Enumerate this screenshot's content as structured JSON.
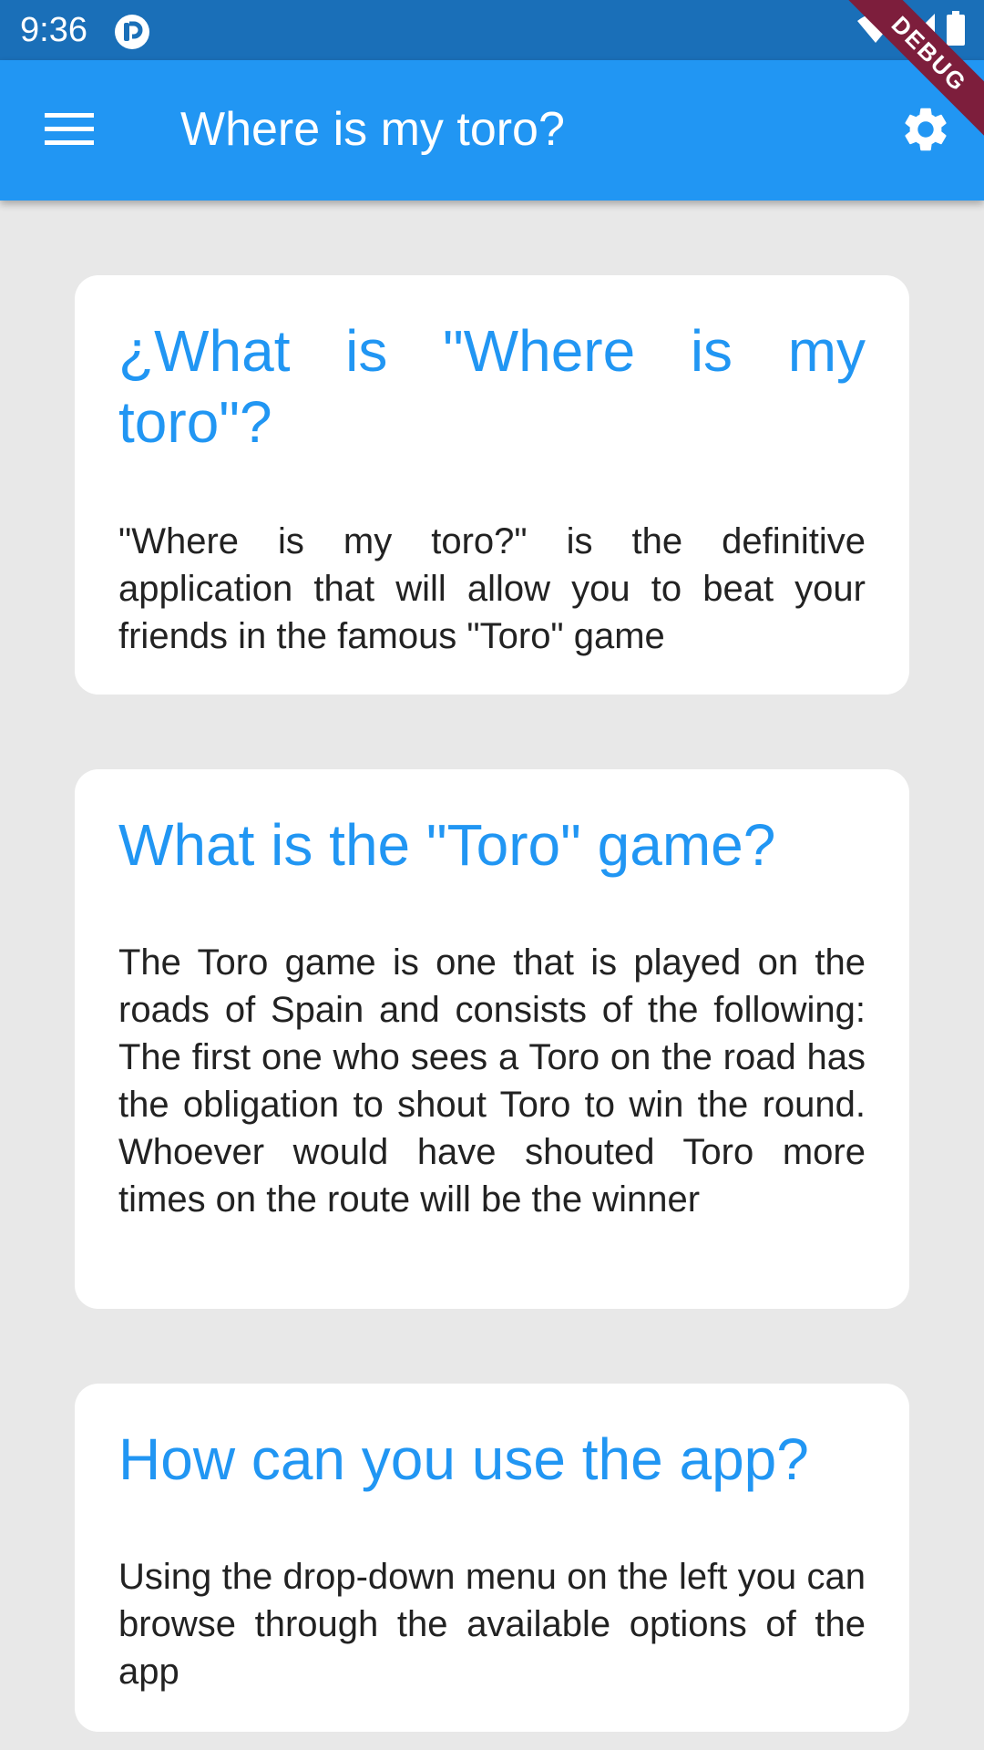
{
  "status_bar": {
    "time": "9:36",
    "icons": [
      "app-notification-icon",
      "wifi-icon",
      "cellular-signal-icon",
      "battery-icon"
    ]
  },
  "app_bar": {
    "title": "Where is my toro?",
    "menu_icon": "hamburger-menu-icon",
    "settings_icon": "gear-icon",
    "color": "#2196f3"
  },
  "debug_banner": {
    "label": "DEBUG"
  },
  "cards": [
    {
      "title": "¿What is \"Where is my toro\"?",
      "body": "\"Where is my toro?\" is the definitive application that will allow you to beat your friends in the famous \"Toro\" game"
    },
    {
      "title": "What is the \"Toro\" game?",
      "body": "The Toro game is one that is played on the roads of Spain and consists of the following: The first one who sees a Toro on the road has the obligation to shout Toro to win the round. Whoever would have shouted Toro more times on the route will be the winner"
    },
    {
      "title": "How can you use the app?",
      "body": "Using the drop-down menu on the left you can browse through the available options of the app"
    }
  ],
  "colors": {
    "accent": "#2196f3",
    "status_bar": "#1a6fb8",
    "background": "#e8e8e8",
    "debug_ribbon": "#7d1e3c"
  }
}
